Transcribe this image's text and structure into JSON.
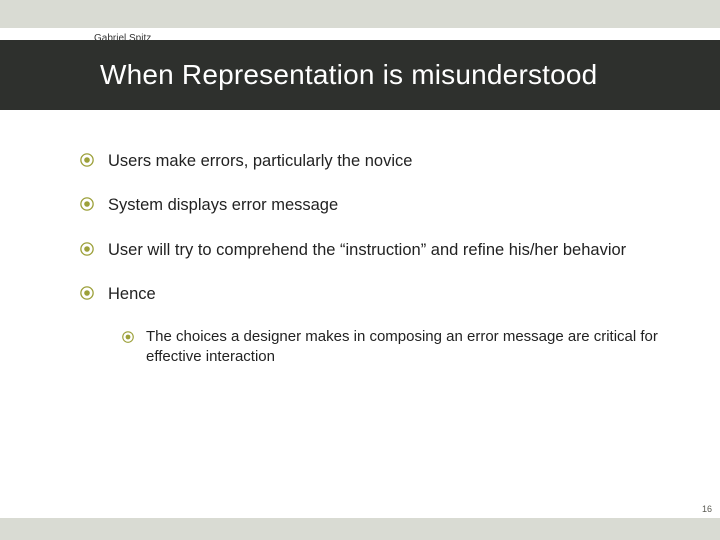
{
  "author": "Gabriel Spitz",
  "title": "When Representation is misunderstood",
  "bullets": [
    "Users make errors, particularly the novice",
    "System displays error message",
    "User will try to comprehend the “instruction” and refine his/her behavior",
    "Hence"
  ],
  "sub_bullets": [
    "The choices a designer makes in composing an error message are critical for effective interaction"
  ],
  "page_number": "16"
}
